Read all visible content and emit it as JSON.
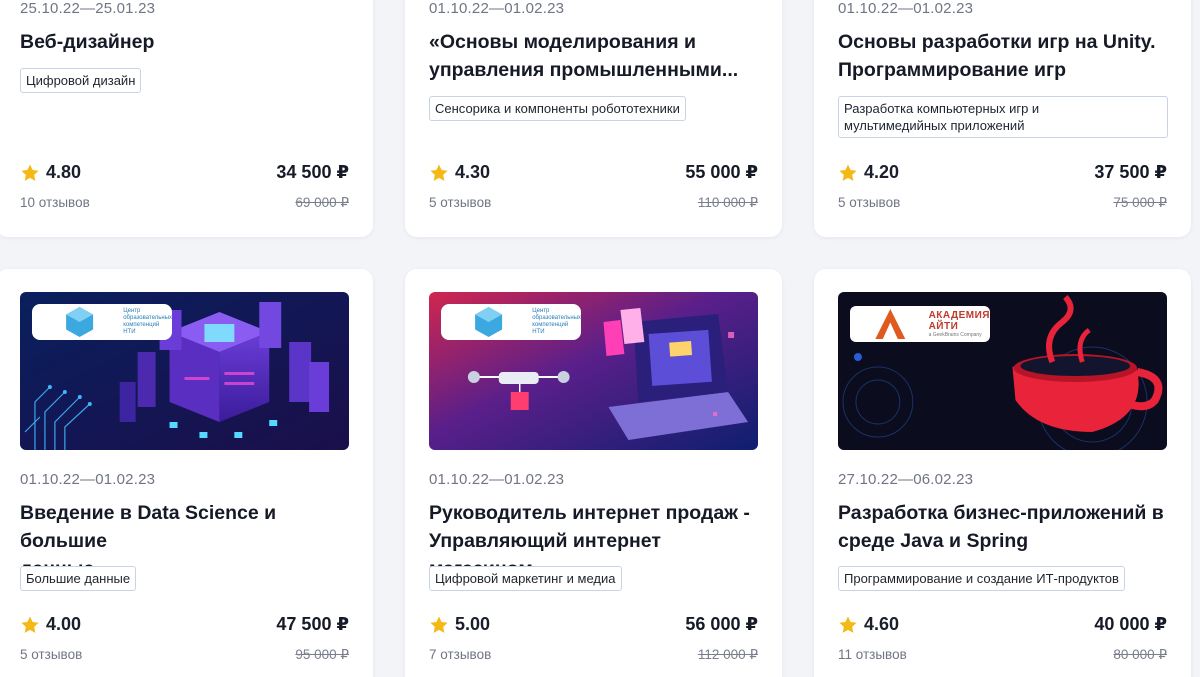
{
  "cards": [
    {
      "dates": "25.10.22—25.01.23",
      "title_lines": [
        "Веб-дизайнер"
      ],
      "tag_lines": [
        "Цифровой дизайн"
      ],
      "rating": "4.80",
      "price": "34 500 ₽",
      "reviews": "10 отзывов",
      "old_price": "69 000 ₽"
    },
    {
      "dates": "01.10.22—01.02.23",
      "title_lines": [
        "«Основы моделирования и",
        "управления промышленными..."
      ],
      "tag_lines": [
        "Сенсорика и компоненты робототехники"
      ],
      "rating": "4.30",
      "price": "55 000 ₽",
      "reviews": "5 отзывов",
      "old_price": "110 000 ₽"
    },
    {
      "dates": "01.10.22—01.02.23",
      "title_lines": [
        "Основы разработки игр на Unity.",
        "Программирование игр"
      ],
      "tag_lines": [
        "Разработка компьютерных игр и",
        "мультимедийных приложений"
      ],
      "rating": "4.20",
      "price": "37 500 ₽",
      "reviews": "5 отзывов",
      "old_price": "75 000 ₽"
    },
    {
      "dates": "01.10.22—01.02.23",
      "title_lines": [
        "Введение в Data Science и большие",
        "данные"
      ],
      "tag_lines": [
        "Большие данные"
      ],
      "rating": "4.00",
      "price": "47 500 ₽",
      "reviews": "5 отзывов",
      "old_price": "95 000 ₽",
      "logo_lines": [
        "Центр",
        "образовательных",
        "компетенций НТИ"
      ]
    },
    {
      "dates": "01.10.22—01.02.23",
      "title_lines": [
        "Руководитель интернет продаж -",
        "Управляющий интернет магазином"
      ],
      "tag_lines": [
        "Цифровой маркетинг и медиа"
      ],
      "rating": "5.00",
      "price": "56 000 ₽",
      "reviews": "7 отзывов",
      "old_price": "112 000 ₽",
      "logo_lines": [
        "Центр",
        "образовательных",
        "компетенций НТИ"
      ]
    },
    {
      "dates": "27.10.22—06.02.23",
      "title_lines": [
        "Разработка бизнес-приложений в",
        "среде Java и Spring"
      ],
      "tag_lines": [
        "Программирование и создание ИТ-продуктов"
      ],
      "rating": "4.60",
      "price": "40 000 ₽",
      "reviews": "11 отзывов",
      "old_price": "80 000 ₽",
      "logo_lines": [
        "АКАДЕМИЯ АЙТИ",
        "a GeekBrains Company"
      ]
    }
  ],
  "colors": {
    "star": "#f5b915",
    "tag_border": "#c9d3e6",
    "banner_blue": "#0b1d5c",
    "banner_purple": "#3a1a7a",
    "cup_red": "#e8233a"
  }
}
